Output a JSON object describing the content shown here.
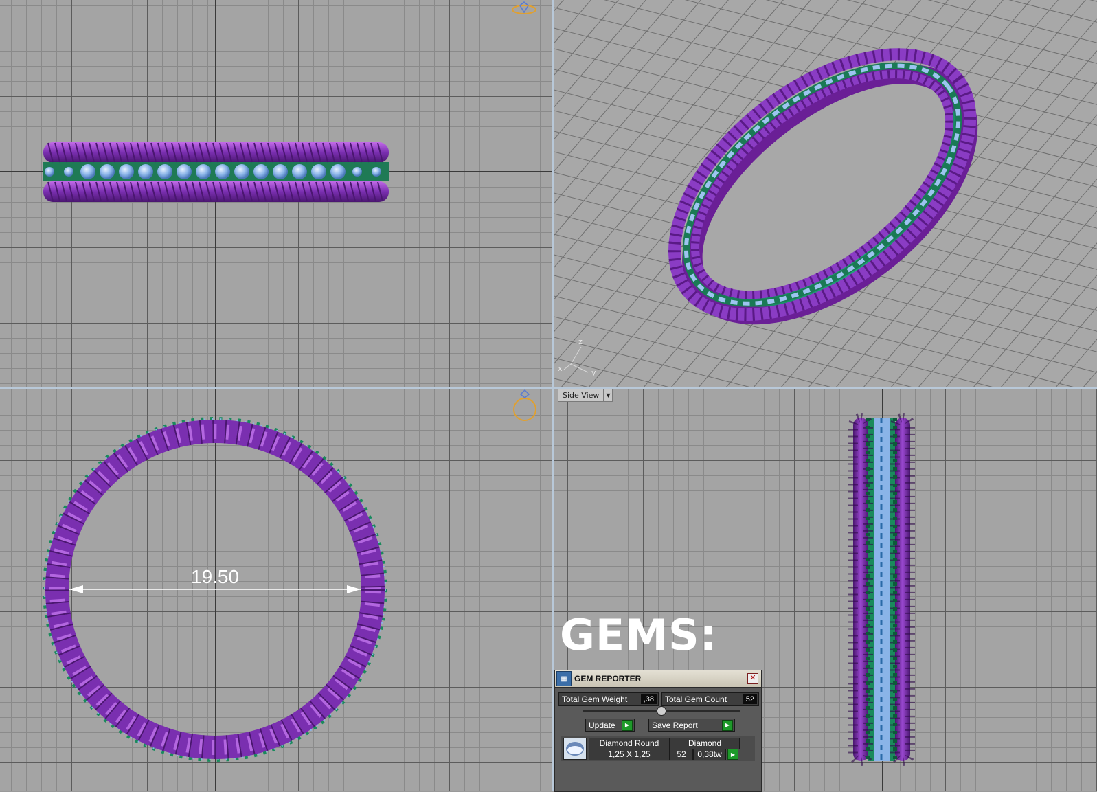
{
  "viewports": {
    "side": {
      "view_label": "Side View"
    }
  },
  "dimension": {
    "value": "19.50"
  },
  "axes": {
    "x": "x",
    "y": "y",
    "z": "z"
  },
  "heading": {
    "text": "GEMS:"
  },
  "gem_reporter": {
    "title": "GEM REPORTER",
    "total_gem_weight_label": "Total Gem Weight",
    "total_gem_weight_value": ",38",
    "total_gem_count_label": "Total Gem Count",
    "total_gem_count_value": "52",
    "update_label": "Update",
    "save_report_label": "Save Report",
    "rows": [
      {
        "shape": "Diamond Round",
        "size": "1,25 X 1,25",
        "material": "Diamond",
        "count": "52",
        "weight": "0,38tw"
      }
    ]
  },
  "colors": {
    "band_purple": "#7a2fb0",
    "gem_blue": "#8ab4e8",
    "setting_green": "#1a8a5c",
    "grid_bg": "#a4a4a4"
  }
}
